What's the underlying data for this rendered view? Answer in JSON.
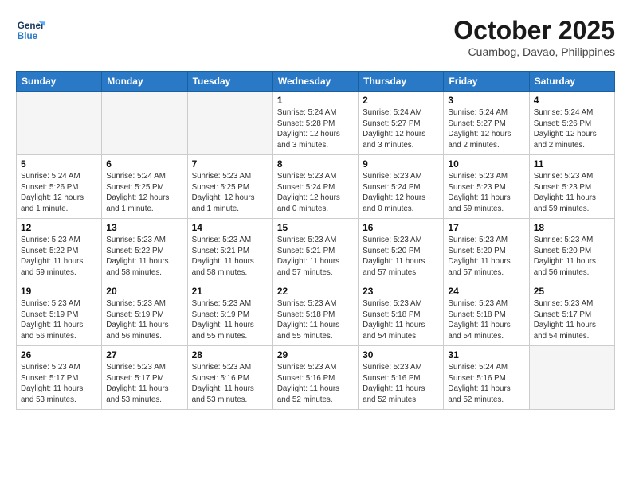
{
  "header": {
    "logo_line1": "General",
    "logo_line2": "Blue",
    "month": "October 2025",
    "location": "Cuambog, Davao, Philippines"
  },
  "weekdays": [
    "Sunday",
    "Monday",
    "Tuesday",
    "Wednesday",
    "Thursday",
    "Friday",
    "Saturday"
  ],
  "weeks": [
    [
      {
        "day": "",
        "info": ""
      },
      {
        "day": "",
        "info": ""
      },
      {
        "day": "",
        "info": ""
      },
      {
        "day": "1",
        "info": "Sunrise: 5:24 AM\nSunset: 5:28 PM\nDaylight: 12 hours\nand 3 minutes."
      },
      {
        "day": "2",
        "info": "Sunrise: 5:24 AM\nSunset: 5:27 PM\nDaylight: 12 hours\nand 3 minutes."
      },
      {
        "day": "3",
        "info": "Sunrise: 5:24 AM\nSunset: 5:27 PM\nDaylight: 12 hours\nand 2 minutes."
      },
      {
        "day": "4",
        "info": "Sunrise: 5:24 AM\nSunset: 5:26 PM\nDaylight: 12 hours\nand 2 minutes."
      }
    ],
    [
      {
        "day": "5",
        "info": "Sunrise: 5:24 AM\nSunset: 5:26 PM\nDaylight: 12 hours\nand 1 minute."
      },
      {
        "day": "6",
        "info": "Sunrise: 5:24 AM\nSunset: 5:25 PM\nDaylight: 12 hours\nand 1 minute."
      },
      {
        "day": "7",
        "info": "Sunrise: 5:23 AM\nSunset: 5:25 PM\nDaylight: 12 hours\nand 1 minute."
      },
      {
        "day": "8",
        "info": "Sunrise: 5:23 AM\nSunset: 5:24 PM\nDaylight: 12 hours\nand 0 minutes."
      },
      {
        "day": "9",
        "info": "Sunrise: 5:23 AM\nSunset: 5:24 PM\nDaylight: 12 hours\nand 0 minutes."
      },
      {
        "day": "10",
        "info": "Sunrise: 5:23 AM\nSunset: 5:23 PM\nDaylight: 11 hours\nand 59 minutes."
      },
      {
        "day": "11",
        "info": "Sunrise: 5:23 AM\nSunset: 5:23 PM\nDaylight: 11 hours\nand 59 minutes."
      }
    ],
    [
      {
        "day": "12",
        "info": "Sunrise: 5:23 AM\nSunset: 5:22 PM\nDaylight: 11 hours\nand 59 minutes."
      },
      {
        "day": "13",
        "info": "Sunrise: 5:23 AM\nSunset: 5:22 PM\nDaylight: 11 hours\nand 58 minutes."
      },
      {
        "day": "14",
        "info": "Sunrise: 5:23 AM\nSunset: 5:21 PM\nDaylight: 11 hours\nand 58 minutes."
      },
      {
        "day": "15",
        "info": "Sunrise: 5:23 AM\nSunset: 5:21 PM\nDaylight: 11 hours\nand 57 minutes."
      },
      {
        "day": "16",
        "info": "Sunrise: 5:23 AM\nSunset: 5:20 PM\nDaylight: 11 hours\nand 57 minutes."
      },
      {
        "day": "17",
        "info": "Sunrise: 5:23 AM\nSunset: 5:20 PM\nDaylight: 11 hours\nand 57 minutes."
      },
      {
        "day": "18",
        "info": "Sunrise: 5:23 AM\nSunset: 5:20 PM\nDaylight: 11 hours\nand 56 minutes."
      }
    ],
    [
      {
        "day": "19",
        "info": "Sunrise: 5:23 AM\nSunset: 5:19 PM\nDaylight: 11 hours\nand 56 minutes."
      },
      {
        "day": "20",
        "info": "Sunrise: 5:23 AM\nSunset: 5:19 PM\nDaylight: 11 hours\nand 56 minutes."
      },
      {
        "day": "21",
        "info": "Sunrise: 5:23 AM\nSunset: 5:19 PM\nDaylight: 11 hours\nand 55 minutes."
      },
      {
        "day": "22",
        "info": "Sunrise: 5:23 AM\nSunset: 5:18 PM\nDaylight: 11 hours\nand 55 minutes."
      },
      {
        "day": "23",
        "info": "Sunrise: 5:23 AM\nSunset: 5:18 PM\nDaylight: 11 hours\nand 54 minutes."
      },
      {
        "day": "24",
        "info": "Sunrise: 5:23 AM\nSunset: 5:18 PM\nDaylight: 11 hours\nand 54 minutes."
      },
      {
        "day": "25",
        "info": "Sunrise: 5:23 AM\nSunset: 5:17 PM\nDaylight: 11 hours\nand 54 minutes."
      }
    ],
    [
      {
        "day": "26",
        "info": "Sunrise: 5:23 AM\nSunset: 5:17 PM\nDaylight: 11 hours\nand 53 minutes."
      },
      {
        "day": "27",
        "info": "Sunrise: 5:23 AM\nSunset: 5:17 PM\nDaylight: 11 hours\nand 53 minutes."
      },
      {
        "day": "28",
        "info": "Sunrise: 5:23 AM\nSunset: 5:16 PM\nDaylight: 11 hours\nand 53 minutes."
      },
      {
        "day": "29",
        "info": "Sunrise: 5:23 AM\nSunset: 5:16 PM\nDaylight: 11 hours\nand 52 minutes."
      },
      {
        "day": "30",
        "info": "Sunrise: 5:23 AM\nSunset: 5:16 PM\nDaylight: 11 hours\nand 52 minutes."
      },
      {
        "day": "31",
        "info": "Sunrise: 5:24 AM\nSunset: 5:16 PM\nDaylight: 11 hours\nand 52 minutes."
      },
      {
        "day": "",
        "info": ""
      }
    ]
  ]
}
